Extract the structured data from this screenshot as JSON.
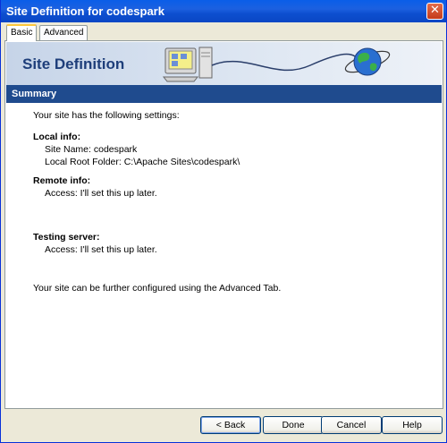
{
  "window": {
    "title": "Site Definition for codespark",
    "close_symbol": "✕"
  },
  "tabs": [
    {
      "label": "Basic",
      "active": true
    },
    {
      "label": "Advanced",
      "active": false
    }
  ],
  "banner": {
    "title": "Site Definition"
  },
  "section": {
    "title": "Summary"
  },
  "content": {
    "intro": "Your site has the following settings:",
    "local_heading": "Local info:",
    "site_name": "Site Name: codespark",
    "local_root": "Local Root Folder: C:\\Apache Sites\\codespark\\",
    "remote_heading": "Remote info:",
    "remote_access": "Access: I'll set this up later.",
    "testing_heading": "Testing server:",
    "testing_access": "Access: I'll set this up later.",
    "footer_note": "Your site can be further configured using the Advanced Tab."
  },
  "buttons": {
    "back": "< Back",
    "done": "Done",
    "cancel": "Cancel",
    "help": "Help"
  },
  "icons": {
    "computer": "computer-icon",
    "globe": "globe-icon"
  },
  "colors": {
    "title_bar": "#0a5ee8",
    "summary_bar": "#1f4b8e",
    "banner_text": "#1e3e7a"
  }
}
